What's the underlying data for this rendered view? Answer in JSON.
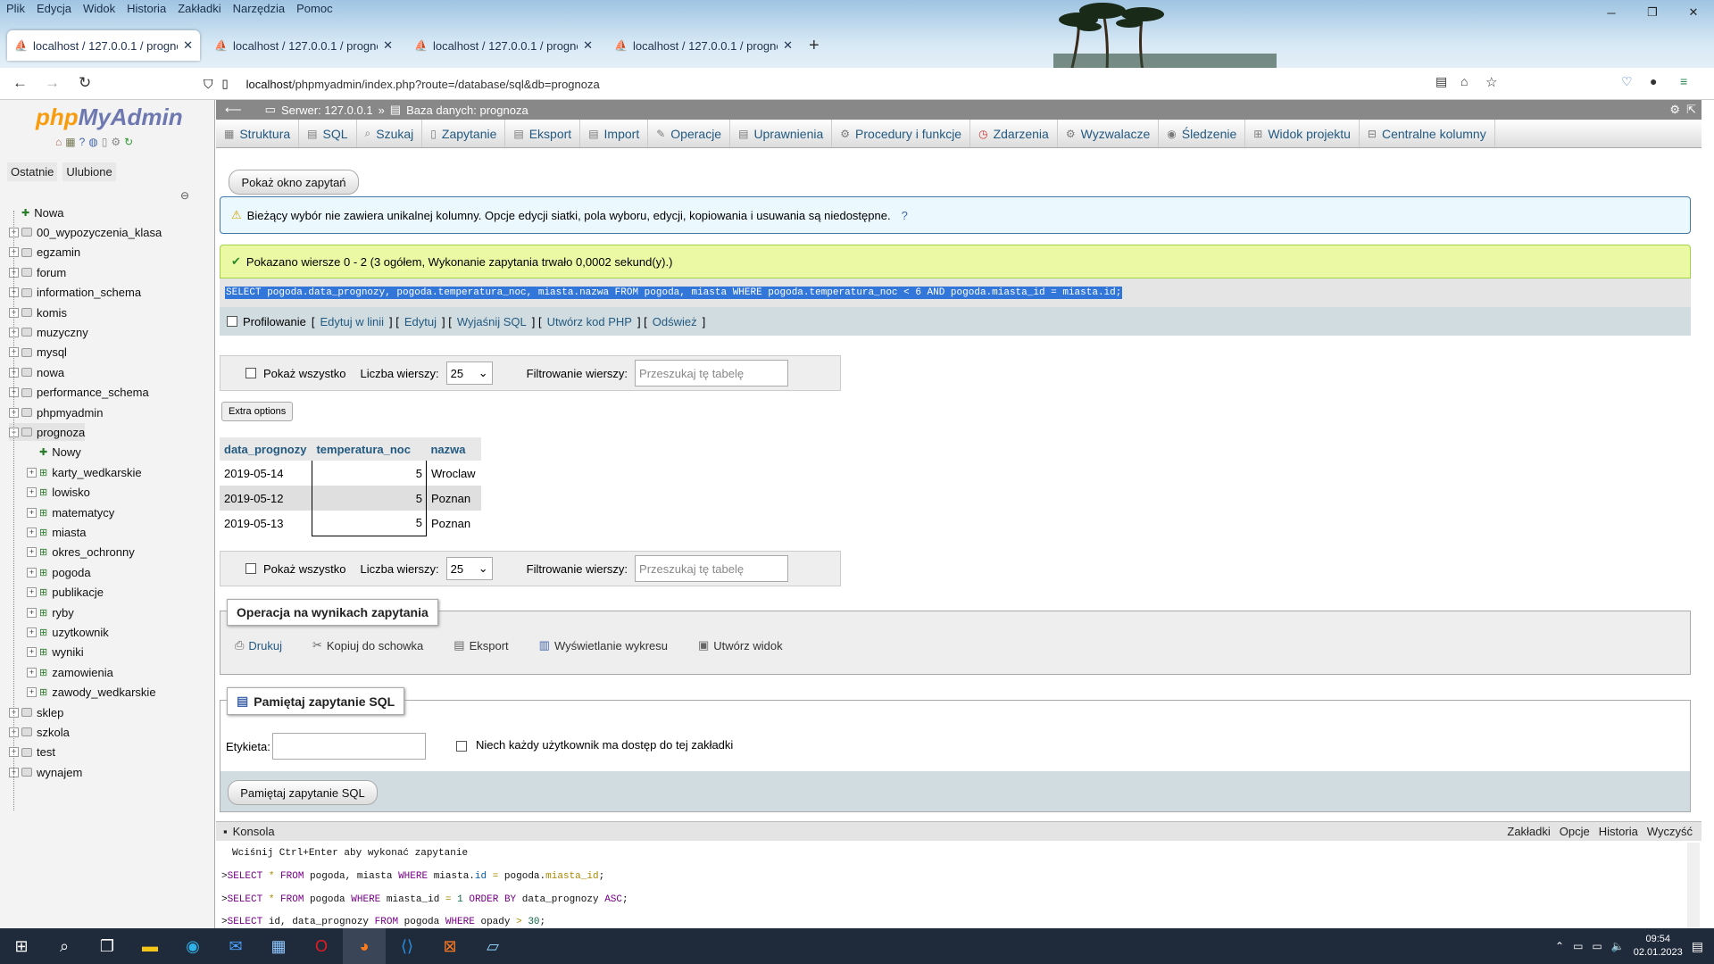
{
  "browser": {
    "menu": [
      "Plik",
      "Edycja",
      "Widok",
      "Historia",
      "Zakładki",
      "Narzędzia",
      "Pomoc"
    ],
    "tabs": [
      {
        "title": "localhost / 127.0.0.1 / prognoza"
      },
      {
        "title": "localhost / 127.0.0.1 / prognoza"
      },
      {
        "title": "localhost / 127.0.0.1 / prognoza"
      },
      {
        "title": "localhost / 127.0.0.1 / prognoza"
      }
    ],
    "url_host": "localhost",
    "url_path": "/phpmyadmin/index.php?route=/database/sql&db=prognoza"
  },
  "left": {
    "logo_a": "php",
    "logo_b": "MyAdmin",
    "tabs": [
      "Ostatnie",
      "Ulubione"
    ],
    "new": "Nowa",
    "databases": [
      "00_wypozyczenia_klasa",
      "egzamin",
      "forum",
      "information_schema",
      "komis",
      "muzyczny",
      "mysql",
      "nowa",
      "performance_schema",
      "phpmyadmin",
      "prognoza"
    ],
    "new_table": "Nowy",
    "tables": [
      "karty_wedkarskie",
      "lowisko",
      "matematycy",
      "miasta",
      "okres_ochronny",
      "pogoda",
      "publikacje",
      "ryby",
      "uzytkownik",
      "wyniki",
      "zamowienia",
      "zawody_wedkarskie"
    ],
    "databases_after": [
      "sklep",
      "szkola",
      "test",
      "wynajem"
    ]
  },
  "server_bar": {
    "server": "Serwer: 127.0.0.1",
    "sep": "»",
    "database": "Baza danych: prognoza"
  },
  "menu_tabs": [
    "Struktura",
    "SQL",
    "Szukaj",
    "Zapytanie",
    "Eksport",
    "Import",
    "Operacje",
    "Uprawnienia",
    "Procedury i funkcje",
    "Zdarzenia",
    "Wyzwalacze",
    "Śledzenie",
    "Widok projektu",
    "Centralne kolumny"
  ],
  "show_query_btn": "Pokaż okno zapytań",
  "warning": "Bieżący wybór nie zawiera unikalnej kolumny. Opcje edycji siatki, pola wyboru, edycji, kopiowania i usuwania są niedostępne.",
  "success": "Pokazano wiersze 0 - 2 (3 ogółem, Wykonanie zapytania trwało 0,0002 sekund(y).)",
  "sql": "SELECT pogoda.data_prognozy, pogoda.temperatura_noc, miasta.nazwa FROM pogoda, miasta WHERE pogoda.temperatura_noc < 6 AND pogoda.miasta_id = miasta.id;",
  "profiling": {
    "label": "Profilowanie",
    "links": [
      "Edytuj w linii",
      "Edytuj",
      "Wyjaśnij SQL",
      "Utwórz kod PHP",
      "Odśwież"
    ]
  },
  "nav": {
    "show_all": "Pokaż wszystko",
    "rows_label": "Liczba wierszy:",
    "rows_value": "25",
    "filter_label": "Filtrowanie wierszy:",
    "filter_placeholder": "Przeszukaj tę tabelę"
  },
  "extra_options": "Extra options",
  "results": {
    "columns": [
      "data_prognozy",
      "temperatura_noc",
      "nazwa"
    ],
    "rows": [
      [
        "2019-05-14",
        "5",
        "Wroclaw"
      ],
      [
        "2019-05-12",
        "5",
        "Poznan"
      ],
      [
        "2019-05-13",
        "5",
        "Poznan"
      ]
    ]
  },
  "ops": {
    "legend": "Operacja na wynikach zapytania",
    "items": [
      "Drukuj",
      "Kopiuj do schowka",
      "Eksport",
      "Wyświetlanie wykresu",
      "Utwórz widok"
    ]
  },
  "bookmark": {
    "legend": "Pamiętaj zapytanie SQL",
    "label": "Etykieta:",
    "share": "Niech każdy użytkownik ma dostęp do tej zakładki",
    "button": "Pamiętaj zapytanie SQL"
  },
  "console": {
    "title": "Konsola",
    "links": [
      "Zakładki",
      "Opcje",
      "Historia",
      "Wyczyść"
    ],
    "hint": "Wciśnij Ctrl+Enter aby wykonać zapytanie"
  },
  "taskbar": {
    "time": "09:54",
    "date": "02.01.2023"
  }
}
